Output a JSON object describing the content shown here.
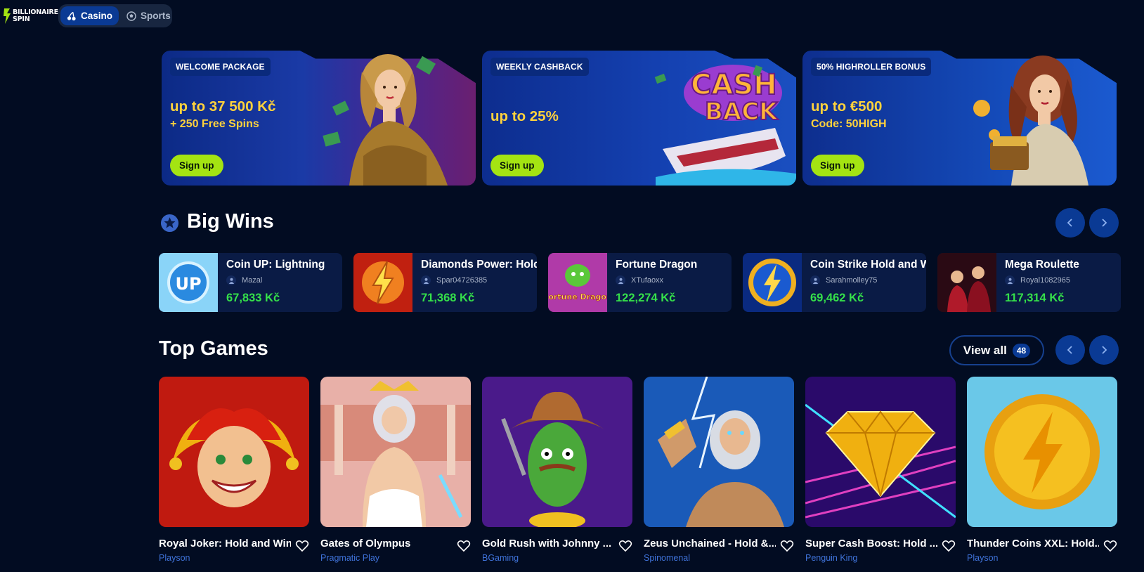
{
  "header": {
    "logo_line1": "BILLIONAIRE",
    "logo_line2": "SPIN",
    "modes": [
      {
        "label": "Casino",
        "icon": "cherries-icon",
        "active": true
      },
      {
        "label": "Sports",
        "icon": "soccer-ball-icon",
        "active": false
      }
    ]
  },
  "promos": [
    {
      "tag": "WELCOME PACKAGE",
      "title": "up to 37 500 Kč",
      "subtitle": "+ 250 Free Spins",
      "button": "Sign up"
    },
    {
      "tag": "WEEKLY CASHBACK",
      "title": "up to 25%",
      "subtitle": "",
      "button": "Sign up",
      "art_text_1": "CASH",
      "art_text_2": "BACK"
    },
    {
      "tag": "50% HIGHROLLER BONUS",
      "title": "up to €500",
      "subtitle": "Code: 50HIGH",
      "button": "Sign up"
    }
  ],
  "big_wins": {
    "title": "Big Wins",
    "items": [
      {
        "game": "Coin UP: Lightning",
        "user": "Mazal",
        "amount": "67,833 Kč",
        "thumb_text": "UP"
      },
      {
        "game": "Diamonds Power: Hold and Win",
        "user": "Spar04726385",
        "amount": "71,368 Kč"
      },
      {
        "game": "Fortune Dragon",
        "user": "XTufaoxx",
        "amount": "122,274 Kč",
        "thumb_text": "Fortune Dragon"
      },
      {
        "game": "Coin Strike Hold and Win",
        "user": "Sarahmolley75",
        "amount": "69,462 Kč"
      },
      {
        "game": "Mega Roulette",
        "user": "Royal1082965",
        "amount": "117,314 Kč"
      }
    ]
  },
  "top_games": {
    "title": "Top Games",
    "view_all_label": "View all",
    "view_all_count": "48",
    "items": [
      {
        "title": "Royal Joker: Hold and Win",
        "provider": "Playson"
      },
      {
        "title": "Gates of Olympus",
        "provider": "Pragmatic Play"
      },
      {
        "title": "Gold Rush with Johnny ...",
        "provider": "BGaming"
      },
      {
        "title": "Zeus Unchained - Hold &...",
        "provider": "Spinomenal"
      },
      {
        "title": "Super Cash Boost: Hold ...",
        "provider": "Penguin King"
      },
      {
        "title": "Thunder Coins XXL: Hold...",
        "provider": "Playson"
      }
    ]
  },
  "colors": {
    "background": "#020c22",
    "accent_blue": "#0a3a94",
    "signup_green": "#a4e412",
    "promo_yellow": "#ffd23c",
    "win_green": "#35e04a",
    "provider_blue": "#3f72d8"
  }
}
